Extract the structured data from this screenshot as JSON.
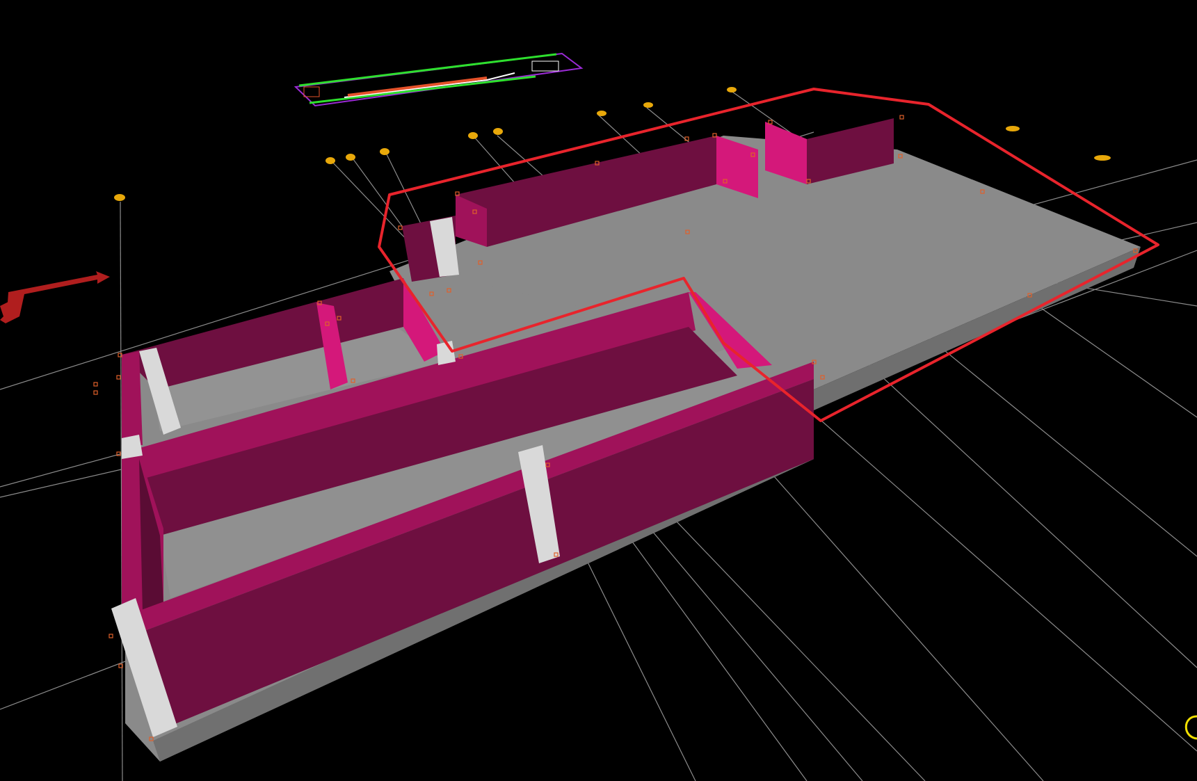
{
  "scene": {
    "background": "#000000",
    "grid_color": "#8c8c8c",
    "wall_dark": "#6e0f40",
    "wall_mid": "#a0125a",
    "wall_light": "#d4187a",
    "floor_color": "#8a8a8a",
    "floor_side": "#6f6f6f",
    "column_color": "#d9d9d9",
    "selection_color": "#e8242c",
    "marker_color": "#e0602a",
    "grid_bubble_color": "#e8a80a",
    "ucs_arrow_color": "#b01e1e"
  },
  "objects": [
    {
      "name": "selection-outline",
      "icon": "polyline-selection"
    },
    {
      "name": "floor-slab",
      "icon": "slab"
    },
    {
      "name": "wall-segments",
      "icon": "wall"
    },
    {
      "name": "columns",
      "icon": "column"
    },
    {
      "name": "grid-lines",
      "icon": "axis-grid"
    },
    {
      "name": "plan-thumbnail",
      "icon": "floor-plan"
    },
    {
      "name": "ucs-arrow",
      "icon": "ucs-icon"
    },
    {
      "name": "viewcube-ring",
      "icon": "ring-icon"
    }
  ]
}
